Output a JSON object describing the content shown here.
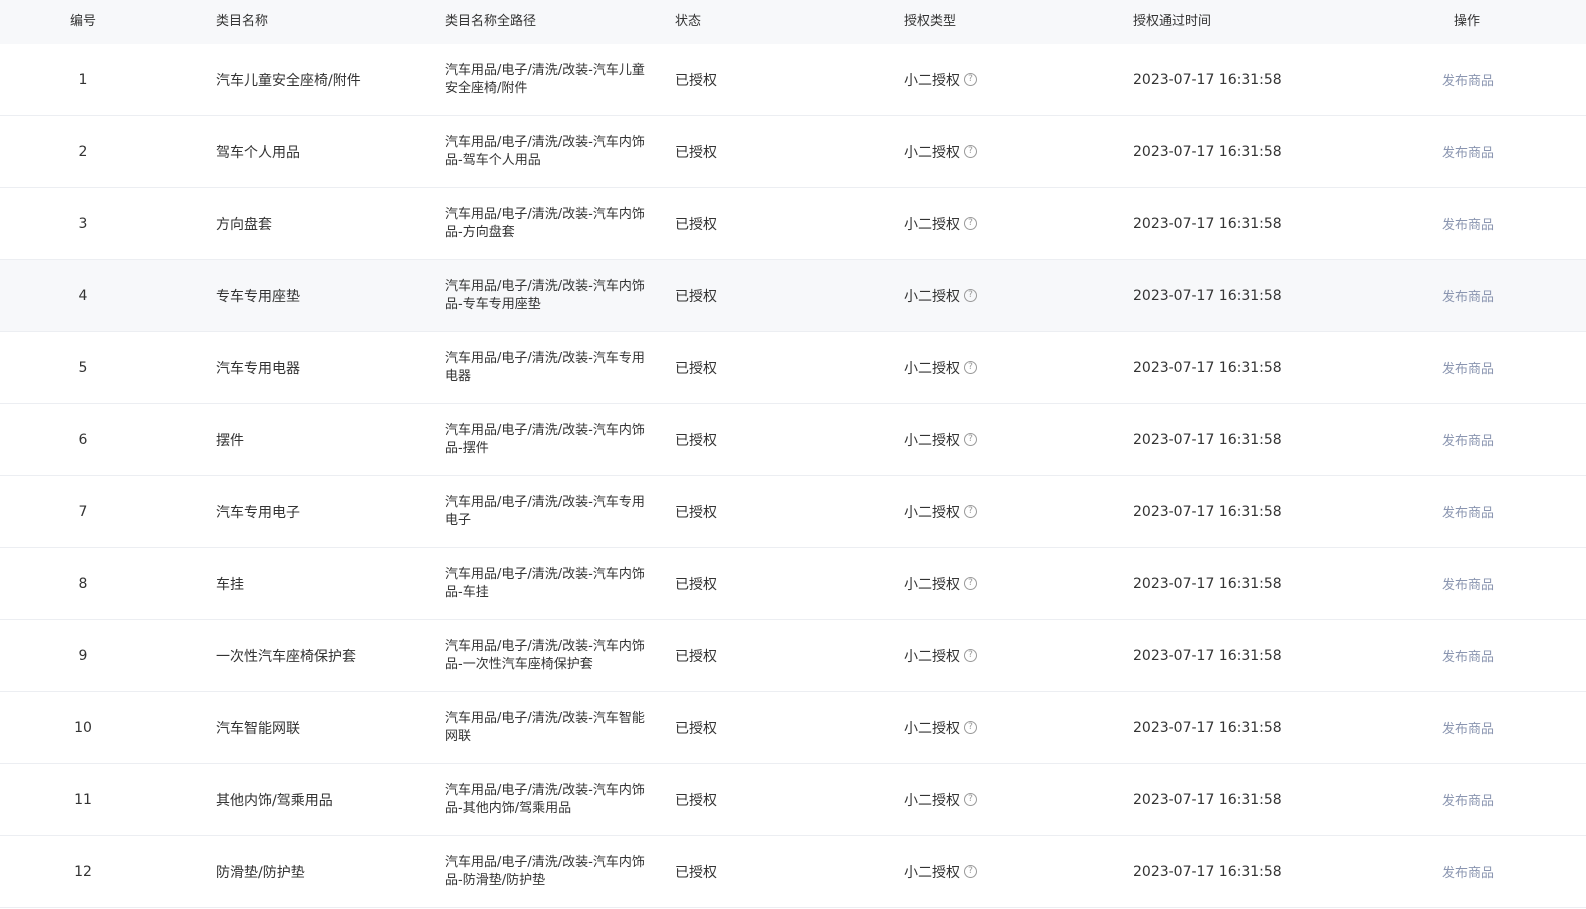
{
  "headers": {
    "no": "编号",
    "name": "类目名称",
    "path": "类目名称全路径",
    "status": "状态",
    "auth_type": "授权类型",
    "auth_time": "授权通过时间",
    "action": "操作"
  },
  "rows": [
    {
      "no": "1",
      "name": "汽车儿童安全座椅/附件",
      "path": "汽车用品/电子/清洗/改装-汽车儿童安全座椅/附件",
      "status": "已授权",
      "auth_type": "小二授权",
      "auth_time": "2023-07-17 16:31:58",
      "action": "发布商品"
    },
    {
      "no": "2",
      "name": "驾车个人用品",
      "path": "汽车用品/电子/清洗/改装-汽车内饰品-驾车个人用品",
      "status": "已授权",
      "auth_type": "小二授权",
      "auth_time": "2023-07-17 16:31:58",
      "action": "发布商品"
    },
    {
      "no": "3",
      "name": "方向盘套",
      "path": "汽车用品/电子/清洗/改装-汽车内饰品-方向盘套",
      "status": "已授权",
      "auth_type": "小二授权",
      "auth_time": "2023-07-17 16:31:58",
      "action": "发布商品"
    },
    {
      "no": "4",
      "name": "专车专用座垫",
      "path": "汽车用品/电子/清洗/改装-汽车内饰品-专车专用座垫",
      "status": "已授权",
      "auth_type": "小二授权",
      "auth_time": "2023-07-17 16:31:58",
      "action": "发布商品"
    },
    {
      "no": "5",
      "name": "汽车专用电器",
      "path": "汽车用品/电子/清洗/改装-汽车专用电器",
      "status": "已授权",
      "auth_type": "小二授权",
      "auth_time": "2023-07-17 16:31:58",
      "action": "发布商品"
    },
    {
      "no": "6",
      "name": "摆件",
      "path": "汽车用品/电子/清洗/改装-汽车内饰品-摆件",
      "status": "已授权",
      "auth_type": "小二授权",
      "auth_time": "2023-07-17 16:31:58",
      "action": "发布商品"
    },
    {
      "no": "7",
      "name": "汽车专用电子",
      "path": "汽车用品/电子/清洗/改装-汽车专用电子",
      "status": "已授权",
      "auth_type": "小二授权",
      "auth_time": "2023-07-17 16:31:58",
      "action": "发布商品"
    },
    {
      "no": "8",
      "name": "车挂",
      "path": "汽车用品/电子/清洗/改装-汽车内饰品-车挂",
      "status": "已授权",
      "auth_type": "小二授权",
      "auth_time": "2023-07-17 16:31:58",
      "action": "发布商品"
    },
    {
      "no": "9",
      "name": "一次性汽车座椅保护套",
      "path": "汽车用品/电子/清洗/改装-汽车内饰品-一次性汽车座椅保护套",
      "status": "已授权",
      "auth_type": "小二授权",
      "auth_time": "2023-07-17 16:31:58",
      "action": "发布商品"
    },
    {
      "no": "10",
      "name": "汽车智能网联",
      "path": "汽车用品/电子/清洗/改装-汽车智能网联",
      "status": "已授权",
      "auth_type": "小二授权",
      "auth_time": "2023-07-17 16:31:58",
      "action": "发布商品"
    },
    {
      "no": "11",
      "name": "其他内饰/驾乘用品",
      "path": "汽车用品/电子/清洗/改装-汽车内饰品-其他内饰/驾乘用品",
      "status": "已授权",
      "auth_type": "小二授权",
      "auth_time": "2023-07-17 16:31:58",
      "action": "发布商品"
    },
    {
      "no": "12",
      "name": "防滑垫/防护垫",
      "path": "汽车用品/电子/清洗/改装-汽车内饰品-防滑垫/防护垫",
      "status": "已授权",
      "auth_type": "小二授权",
      "auth_time": "2023-07-17 16:31:58",
      "action": "发布商品"
    }
  ],
  "highlighted_row": 4,
  "icons": {
    "help": "question-circle-icon"
  },
  "colors": {
    "header_bg": "#f7f8fa",
    "link": "#8a95b0",
    "border": "#eceef2",
    "hover_bg": "#f7f8fa"
  }
}
